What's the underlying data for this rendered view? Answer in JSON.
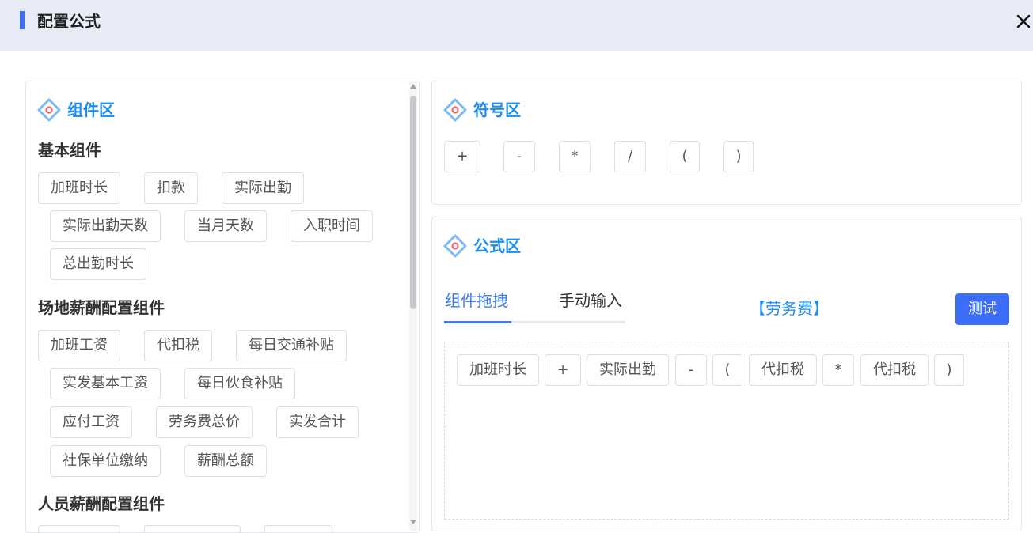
{
  "dialog": {
    "title": "配置公式"
  },
  "components_panel": {
    "title": "组件区",
    "groups": [
      {
        "title": "基本组件",
        "items": [
          "加班时长",
          "扣款",
          "实际出勤",
          "实际出勤天数",
          "当月天数",
          "入职时间",
          "总出勤时长"
        ]
      },
      {
        "title": "场地薪酬配置组件",
        "items": [
          "加班工资",
          "代扣税",
          "每日交通补贴",
          "实发基本工资",
          "每日伙食补贴",
          "应付工资",
          "劳务费总价",
          "实发合计",
          "社保单位缴纳",
          "薪酬总额"
        ]
      },
      {
        "title": "人员薪酬配置组件",
        "items": []
      }
    ]
  },
  "symbols_panel": {
    "title": "符号区",
    "symbols": [
      "+",
      "-",
      "*",
      "/",
      "(",
      ")"
    ]
  },
  "formula_panel": {
    "title": "公式区",
    "tabs": [
      "组件拖拽",
      "手动输入"
    ],
    "active_tab": "组件拖拽",
    "fee_label": "【劳务费】",
    "test_button": "测试",
    "tokens": [
      "加班时长",
      "+",
      "实际出勤",
      "-",
      "(",
      "代扣税",
      "*",
      "代扣税",
      ")"
    ]
  },
  "colors": {
    "accent": "#3d6ef7",
    "section_title": "#1b8df5",
    "header_bg": "#e6ebf5"
  },
  "icons": {
    "close": "close-icon",
    "section": "diamond-section-icon"
  }
}
